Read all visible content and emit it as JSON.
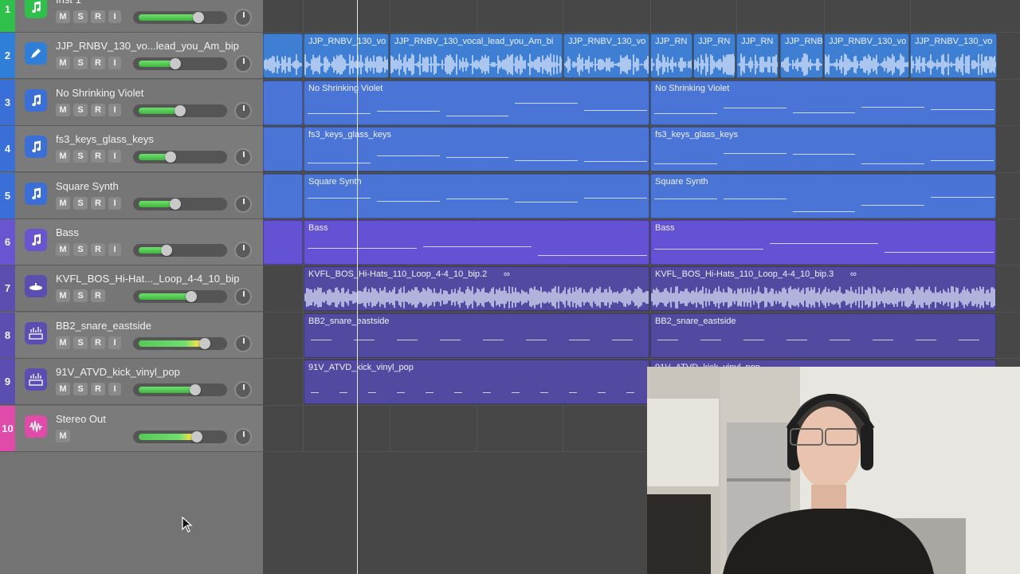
{
  "tracks": [
    {
      "number": "1",
      "name": "Inst 1",
      "icon": "music-note-icon",
      "color": "#2fbf4b",
      "buttons": [
        "M",
        "S",
        "R",
        "I"
      ],
      "volume": 0.72
    },
    {
      "number": "2",
      "name": "JJP_RNBV_130_vo...lead_you_Am_bip",
      "icon": "audio-pen-icon",
      "color": "#2f7fd8",
      "buttons": [
        "M",
        "S",
        "R",
        "I"
      ],
      "volume": 0.44
    },
    {
      "number": "3",
      "name": "No Shrinking Violet",
      "icon": "music-note-icon",
      "color": "#3b6fd8",
      "buttons": [
        "M",
        "S",
        "R",
        "I"
      ],
      "volume": 0.5
    },
    {
      "number": "4",
      "name": "fs3_keys_glass_keys",
      "icon": "music-note-icon",
      "color": "#3b6fd8",
      "buttons": [
        "M",
        "S",
        "R",
        "I"
      ],
      "volume": 0.38
    },
    {
      "number": "5",
      "name": "Square Synth",
      "icon": "music-note-icon",
      "color": "#3b6fd8",
      "buttons": [
        "M",
        "S",
        "R",
        "I"
      ],
      "volume": 0.44
    },
    {
      "number": "6",
      "name": "Bass",
      "icon": "music-note-icon",
      "color": "#6a55d0",
      "buttons": [
        "M",
        "S",
        "R",
        "I"
      ],
      "volume": 0.34
    },
    {
      "number": "7",
      "name": "KVFL_BOS_Hi-Hat..._Loop_4-4_10_bip",
      "icon": "cymbal-icon",
      "color": "#5a4fb0",
      "buttons": [
        "M",
        "S",
        "R"
      ],
      "volume": 0.63
    },
    {
      "number": "8",
      "name": "BB2_snare_eastside",
      "icon": "drum-machine-icon",
      "color": "#5a4fb0",
      "buttons": [
        "M",
        "S",
        "R",
        "I"
      ],
      "volume": 0.8,
      "hot": true
    },
    {
      "number": "9",
      "name": "91V_ATVD_kick_vinyl_pop",
      "icon": "drum-machine-icon",
      "color": "#5a4fb0",
      "buttons": [
        "M",
        "S",
        "R",
        "I"
      ],
      "volume": 0.68
    },
    {
      "number": "10",
      "name": "Stereo Out",
      "icon": "waveform-icon",
      "color": "#e04aa8",
      "buttons": [
        "M"
      ],
      "volume": 0.7,
      "hot": true
    }
  ],
  "regions": {
    "vocal": [
      "JJP_RNBV_130_vo",
      "JJP_RNBV_130_vocal_lead_you_Am_bi",
      "JJP_RNBV_130_vo",
      "JJP_RN",
      "JJP_RN",
      "JJP_RN",
      "JJP_RNB",
      "JJP_RNBV_130_vo",
      "JJP_RNBV_130_vo"
    ],
    "no_shrinking": [
      "No Shrinking Violet",
      "No Shrinking Violet"
    ],
    "keys": [
      "fs3_keys_glass_keys",
      "fs3_keys_glass_keys"
    ],
    "square": [
      "Square Synth",
      "Square Synth"
    ],
    "bass": [
      "Bass",
      "Bass"
    ],
    "hihat": [
      "KVFL_BOS_Hi-Hats_110_Loop_4-4_10_bip.2",
      "KVFL_BOS_Hi-Hats_110_Loop_4-4_10_bip.3"
    ],
    "snare": [
      "BB2_snare_eastside",
      "BB2_snare_eastside"
    ],
    "kick": [
      "91V_ATVD_kick_vinyl_pop",
      "91V_ATVD_kick_vinyl_pop"
    ]
  },
  "loop_icon": "loop-icon",
  "cursor_icon": "arrow-cursor-icon"
}
